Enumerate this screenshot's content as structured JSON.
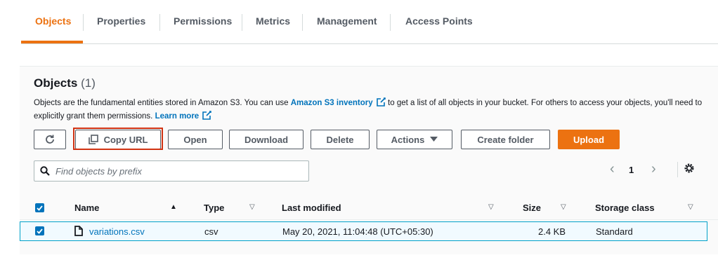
{
  "tabs": {
    "items": [
      {
        "label": "Objects",
        "active": true
      },
      {
        "label": "Properties"
      },
      {
        "label": "Permissions"
      },
      {
        "label": "Metrics"
      },
      {
        "label": "Management"
      },
      {
        "label": "Access Points"
      }
    ]
  },
  "objects": {
    "title": "Objects",
    "count": "(1)",
    "description_part1": "Objects are the fundamental entities stored in Amazon S3. You can use ",
    "inventory_link": "Amazon S3 inventory",
    "description_part2": " to get a list of all objects in your bucket. For others to access your objects, you'll need to explicitly grant them permissions. ",
    "learn_more": "Learn more"
  },
  "toolbar": {
    "refresh_icon": "refresh-icon",
    "copy_url": "Copy URL",
    "open": "Open",
    "download": "Download",
    "delete": "Delete",
    "actions": "Actions",
    "create_folder": "Create folder",
    "upload": "Upload"
  },
  "search": {
    "placeholder": "Find objects by prefix"
  },
  "pagination": {
    "current_page": "1"
  },
  "table": {
    "columns": [
      "Name",
      "Type",
      "Last modified",
      "Size",
      "Storage class"
    ],
    "rows": [
      {
        "name": "variations.csv",
        "type": "csv",
        "last_modified": "May 20, 2021, 11:04:48 (UTC+05:30)",
        "size": "2.4 KB",
        "storage_class": "Standard",
        "selected": true
      }
    ]
  },
  "colors": {
    "accent": "#ec7211",
    "link": "#0073bb",
    "highlight": "#d13212"
  }
}
